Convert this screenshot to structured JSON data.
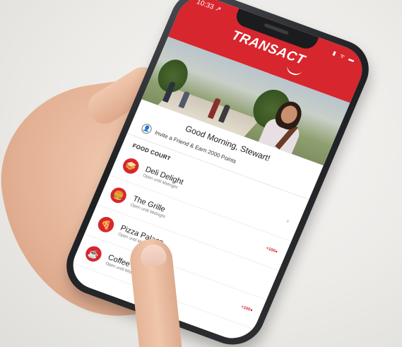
{
  "status_bar": {
    "time": "10:33 ↗",
    "icons": "▮ ᯤ ▬"
  },
  "app": {
    "brand": "TRANSACT",
    "greeting": "Good Morning, Stewart!",
    "invite_text": "Invite a Friend & Earn 2000 Points",
    "section_title": "FOOD COURT",
    "accent_color": "#d7262e"
  },
  "food_court": [
    {
      "name": "Deli Delight",
      "hours": "Open until Midnight",
      "icon": "deli-sandwich-icon",
      "glyph": "🥪",
      "badge": ""
    },
    {
      "name": "The Grille",
      "hours": "Open until Midnight",
      "icon": "burger-icon",
      "glyph": "🍔",
      "badge": "+100●"
    },
    {
      "name": "Pizza Palace",
      "hours": "Open until Midnight",
      "icon": "pizza-icon",
      "glyph": "🍕",
      "badge": ""
    },
    {
      "name": "Coffee Cafe",
      "hours": "Open until Midnight",
      "icon": "coffee-cup-icon",
      "glyph": "☕",
      "badge": "+100●"
    }
  ]
}
